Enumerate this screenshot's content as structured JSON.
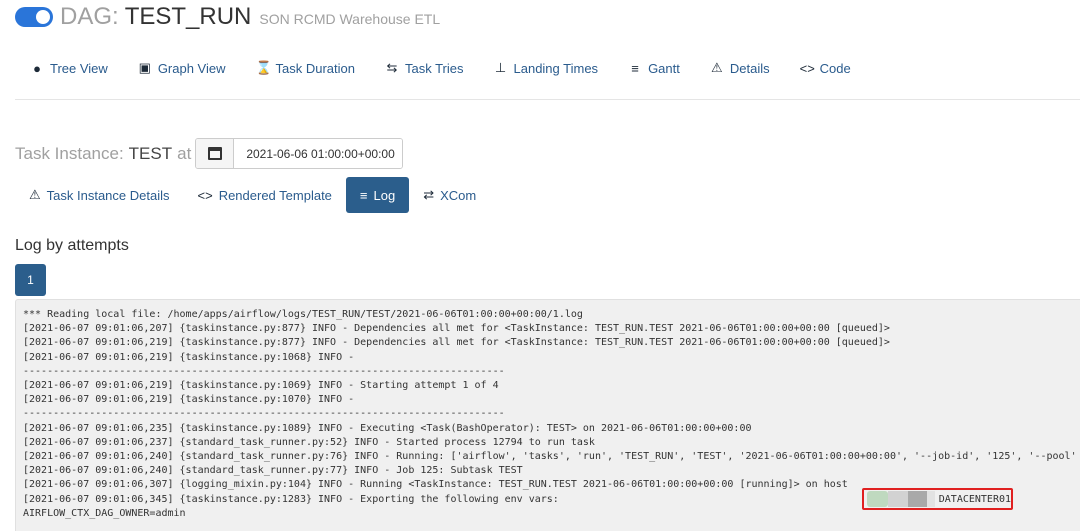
{
  "header": {
    "dag_prefix": "DAG:",
    "dag_id": "TEST_RUN",
    "dag_description": "SON RCMD Warehouse ETL"
  },
  "nav": [
    {
      "label": "Tree View",
      "icon": "tree-icon"
    },
    {
      "label": "Graph View",
      "icon": "graph-icon"
    },
    {
      "label": "Task Duration",
      "icon": "hourglass-icon"
    },
    {
      "label": "Task Tries",
      "icon": "retry-icon"
    },
    {
      "label": "Landing Times",
      "icon": "landing-icon"
    },
    {
      "label": "Gantt",
      "icon": "gantt-icon"
    },
    {
      "label": "Details",
      "icon": "warning-icon"
    },
    {
      "label": "Code",
      "icon": "code-icon"
    }
  ],
  "task_instance": {
    "label": "Task Instance:",
    "task": "TEST",
    "at": "at",
    "execution_date": "2021-06-06 01:00:00+00:00"
  },
  "subnav": [
    {
      "label": "Task Instance Details",
      "icon": "warning-icon"
    },
    {
      "label": "Rendered Template",
      "icon": "code-icon"
    },
    {
      "label": "Log",
      "icon": "list-icon",
      "active": true
    },
    {
      "label": "XCom",
      "icon": "exchange-icon"
    }
  ],
  "log": {
    "heading": "Log by attempts",
    "attempt_label": "1",
    "lines": [
      "*** Reading local file: /home/apps/airflow/logs/TEST_RUN/TEST/2021-06-06T01:00:00+00:00/1.log",
      "[2021-06-07 09:01:06,207] {taskinstance.py:877} INFO - Dependencies all met for <TaskInstance: TEST_RUN.TEST 2021-06-06T01:00:00+00:00 [queued]>",
      "[2021-06-07 09:01:06,219] {taskinstance.py:877} INFO - Dependencies all met for <TaskInstance: TEST_RUN.TEST 2021-06-06T01:00:00+00:00 [queued]>",
      "[2021-06-07 09:01:06,219] {taskinstance.py:1068} INFO -",
      "--------------------------------------------------------------------------------",
      "[2021-06-07 09:01:06,219] {taskinstance.py:1069} INFO - Starting attempt 1 of 4",
      "[2021-06-07 09:01:06,219] {taskinstance.py:1070} INFO -",
      "--------------------------------------------------------------------------------",
      "[2021-06-07 09:01:06,235] {taskinstance.py:1089} INFO - Executing <Task(BashOperator): TEST> on 2021-06-06T01:00:00+00:00",
      "[2021-06-07 09:01:06,237] {standard_task_runner.py:52} INFO - Started process 12794 to run task",
      "[2021-06-07 09:01:06,240] {standard_task_runner.py:76} INFO - Running: ['airflow', 'tasks', 'run', 'TEST_RUN', 'TEST', '2021-06-06T01:00:00+00:00', '--job-id', '125', '--pool'",
      "[2021-06-07 09:01:06,240] {standard_task_runner.py:77} INFO - Job 125: Subtask TEST",
      "[2021-06-07 09:01:06,307] {logging_mixin.py:104} INFO - Running <TaskInstance: TEST_RUN.TEST 2021-06-06T01:00:00+00:00 [running]> on host",
      "[2021-06-07 09:01:06,345] {taskinstance.py:1283} INFO - Exporting the following env vars:",
      "AIRFLOW_CTX_DAG_OWNER=admin"
    ],
    "host_suffix": "DATACENTER01"
  }
}
